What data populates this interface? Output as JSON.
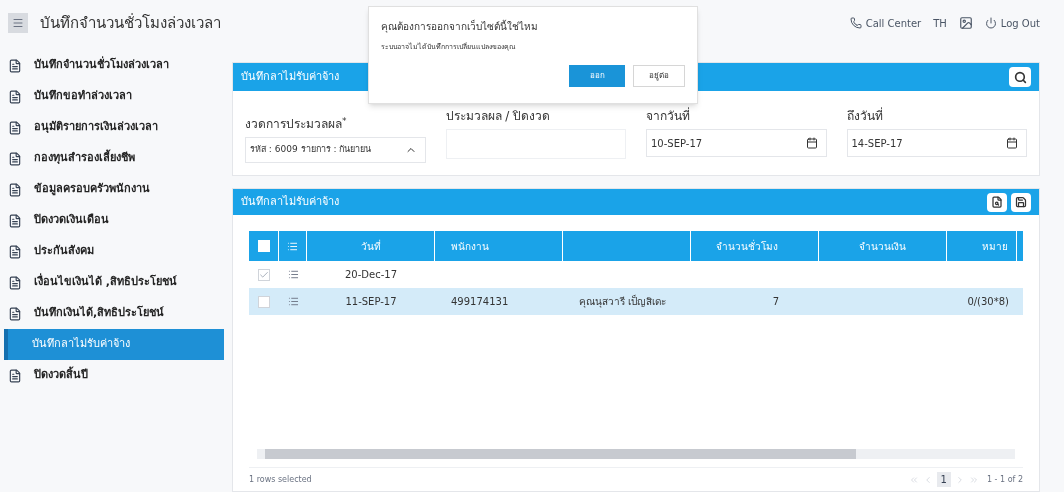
{
  "header": {
    "title": "บันทึกจำนวนชั่วโมงล่วงเวลา",
    "call_center": "Call Center",
    "language": "TH",
    "logout": "Log Out"
  },
  "sidebar": {
    "items": [
      {
        "label": "บันทึกจำนวนชั่วโมงล่วงเวลา",
        "selected": false
      },
      {
        "label": "บันทึกขอทำล่วงเวลา",
        "selected": false
      },
      {
        "label": "อนุมัติรายการเงินล่วงเวลา",
        "selected": false
      },
      {
        "label": "กองทุนสำรองเลี้ยงชีพ",
        "selected": false
      },
      {
        "label": "ข้อมูลครอบครัวพนักงาน",
        "selected": false
      },
      {
        "label": "ปิดงวดเงินเดือน",
        "selected": false
      },
      {
        "label": "ประกันสังคม",
        "selected": false
      },
      {
        "label": "เงื่อนไขเงินได้ ,สิทธิประโยชน์",
        "selected": false
      },
      {
        "label": "บันทึกเงินได้,สิทธิประโยชน์",
        "selected": false
      },
      {
        "label": "บันทึกลาไม่รับค่าจ้าง",
        "selected": true
      },
      {
        "label": "ปิดงวดสิ้นปี",
        "selected": false
      }
    ]
  },
  "search_panel": {
    "title": "บันทึกลาไม่รับค่าจ้าง",
    "period": {
      "label": "งวดการประมวลผล$^{*}$",
      "value": "รหัส : 6009 รายการ : กันยายน"
    },
    "process": {
      "label": "ประมวลผล / ปิดงวด"
    },
    "from_date": {
      "label": "จากวันที่",
      "value": "10-SEP-17"
    },
    "to_date": {
      "label": "ถึงวันที่",
      "value": "14-SEP-17"
    }
  },
  "table_panel": {
    "title": "บันทึกลาไม่รับค่าจ้าง",
    "select_all_checked": false,
    "columns": [
      "วันที่",
      "พนักงาน",
      "",
      "จำนวนชั่วโมง",
      "จำนวนเงิน",
      "หมาย"
    ],
    "rows": [
      {
        "checked": true,
        "selected": false,
        "cells": [
          "20-Dec-17",
          "",
          "",
          "",
          "",
          ""
        ]
      },
      {
        "checked": false,
        "selected": true,
        "cells": [
          "11-SEP-17",
          "499174131",
          "คุณนุสวารี เป็ญสิเดะ",
          "7",
          "",
          "0/(30*8)"
        ]
      }
    ],
    "footer": "1 rows selected",
    "pager": {
      "page": "1",
      "range": "1 - 1 of 2"
    }
  },
  "dialog": {
    "message": "คุณต้องการออกจากเว็บไซต์นี้ใช่ไหม",
    "detail": "ระบบอาจไม่ได้บันทึกการเปลี่ยนแปลงของคุณ",
    "buttons": [
      {
        "label": "ออก",
        "kind": "primary"
      },
      {
        "label": "อยู่ต่อ",
        "kind": "secondary"
      }
    ]
  }
}
